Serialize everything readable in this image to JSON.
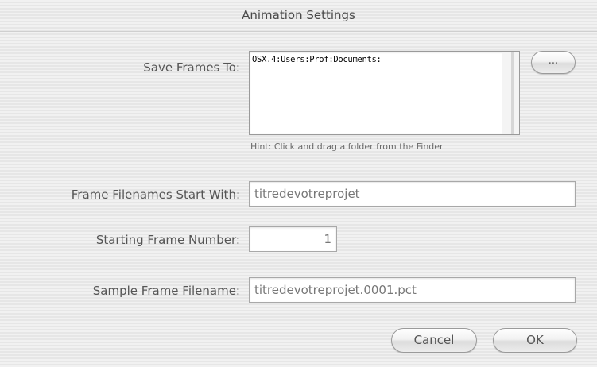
{
  "window": {
    "title": "Animation Settings"
  },
  "save_frames": {
    "label": "Save Frames To:",
    "path": "OSX.4:Users:Prof:Documents:",
    "browse_label": "...",
    "hint": "Hint: Click and drag a folder from the Finder"
  },
  "filename_start": {
    "label": "Frame Filenames Start With:",
    "value": "titredevotreprojet"
  },
  "start_number": {
    "label": "Starting Frame Number:",
    "value": "1"
  },
  "sample_filename": {
    "label": "Sample Frame Filename:",
    "value": "titredevotreprojet.0001.pct"
  },
  "buttons": {
    "cancel": "Cancel",
    "ok": "OK"
  }
}
